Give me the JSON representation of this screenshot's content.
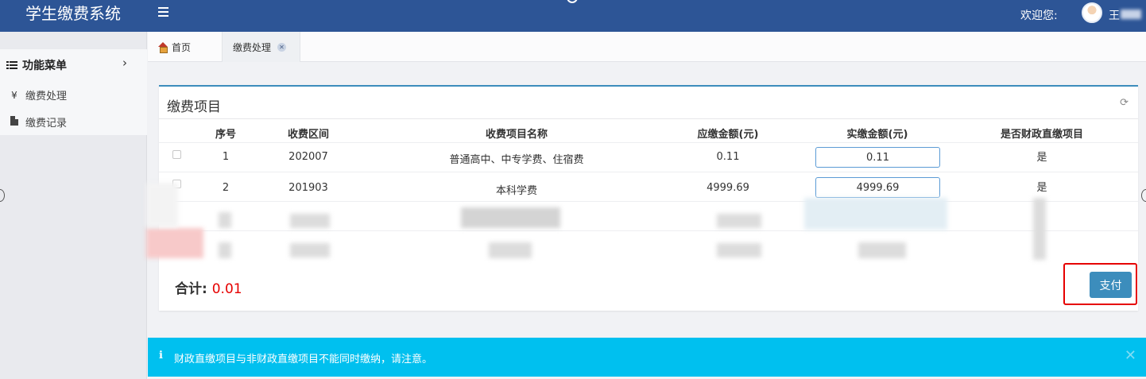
{
  "header": {
    "brand": "学生缴费系统",
    "welcome": "欢迎您:",
    "user_name": "王"
  },
  "sidebar": {
    "menu_title": "功能菜单",
    "items": [
      {
        "icon": "yen-icon",
        "glyph": "¥",
        "label": "缴费处理"
      },
      {
        "icon": "file-icon",
        "label": "缴费记录"
      }
    ]
  },
  "tabs": [
    {
      "icon": "home-icon",
      "label": "首页"
    },
    {
      "label": "缴费处理",
      "active": true
    }
  ],
  "panel": {
    "title": "缴费项目",
    "columns": [
      "序号",
      "收费区间",
      "收费项目名称",
      "应缴金额(元)",
      "实缴金额(元)",
      "是否财政直缴项目"
    ],
    "rows": [
      {
        "seq": "1",
        "period": "202007",
        "name": "普通高中、中专学费、住宿费",
        "due": "0.11",
        "paid": "0.11",
        "fiscal": "是"
      },
      {
        "seq": "2",
        "period": "201903",
        "name": "本科学费",
        "due": "4999.69",
        "paid": "4999.69",
        "fiscal": "是"
      }
    ],
    "total_label": "合计:",
    "total_value": "0.01",
    "pay_button": "支付"
  },
  "alert": {
    "icon": "info-icon",
    "text": "财政直缴项目与非财政直缴项目不能同时缴纳，请注意。"
  },
  "colors": {
    "header": "#2d5596",
    "primary": "#3c8dbc",
    "alert": "#00c0ef",
    "total": "#e60000",
    "highlight": "#e60000"
  }
}
